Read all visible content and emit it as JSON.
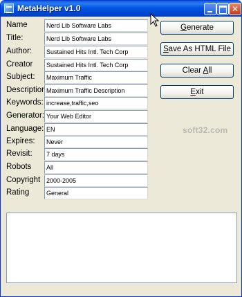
{
  "window": {
    "title": "MetaHelper v1.0"
  },
  "fields": [
    {
      "label": "Name",
      "value": "Nerd Lib Software Labs"
    },
    {
      "label": "Title:",
      "value": "Nerd Lib Software Labs"
    },
    {
      "label": "Author:",
      "value": "Sustained Hits Intl. Tech Corp"
    },
    {
      "label": "Creator",
      "value": "Sustained Hits Intl. Tech Corp"
    },
    {
      "label": "Subject:",
      "value": "Maximum Traffic"
    },
    {
      "label": "Description:",
      "value": "Maximum Traffic Description"
    },
    {
      "label": "Keywords:",
      "value": "increase,traffic,seo"
    },
    {
      "label": "Generator:",
      "value": "Your Web Editor"
    },
    {
      "label": "Language:",
      "value": "EN"
    },
    {
      "label": "Expires:",
      "value": "Never"
    },
    {
      "label": "Revisit:",
      "value": "7 days"
    },
    {
      "label": "Robots",
      "value": "All"
    },
    {
      "label": "Copyright",
      "value": "2000-2005"
    },
    {
      "label": "Rating",
      "value": "General"
    }
  ],
  "buttons": {
    "generate": {
      "pre": "",
      "key": "G",
      "post": "enerate"
    },
    "save_html": {
      "pre": "",
      "key": "S",
      "post": "ave As HTML File"
    },
    "clear_all": {
      "pre": "Clear ",
      "key": "A",
      "post": "ll"
    },
    "exit": {
      "pre": "",
      "key": "E",
      "post": "xit"
    }
  },
  "output": {
    "text": ""
  },
  "watermark": "soft32.com"
}
